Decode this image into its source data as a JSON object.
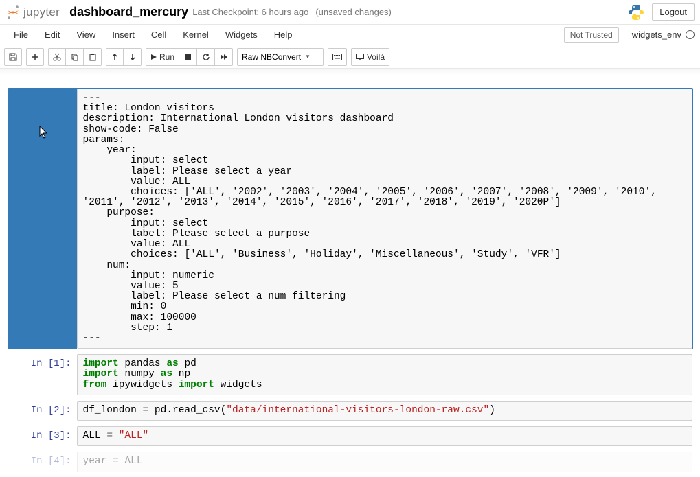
{
  "header": {
    "logo_text": "jupyter",
    "notebook_name": "dashboard_mercury",
    "checkpoint": "Last Checkpoint: 6 hours ago",
    "unsaved": "(unsaved changes)",
    "logout": "Logout"
  },
  "menu": {
    "items": [
      "File",
      "Edit",
      "View",
      "Insert",
      "Cell",
      "Kernel",
      "Widgets",
      "Help"
    ],
    "not_trusted": "Not Trusted",
    "kernel_name": "widgets_env"
  },
  "toolbar": {
    "run_label": "Run",
    "celltype": "Raw NBConvert",
    "voila": "Voilà"
  },
  "cells": {
    "raw0": "---\ntitle: London visitors\ndescription: International London visitors dashboard\nshow-code: False\nparams:\n    year:\n        input: select\n        label: Please select a year\n        value: ALL\n        choices: ['ALL', '2002', '2003', '2004', '2005', '2006', '2007', '2008', '2009', '2010', '2011', '2012', '2013', '2014', '2015', '2016', '2017', '2018', '2019', '2020P']\n    purpose:\n        input: select\n        label: Please select a purpose\n        value: ALL\n        choices: ['ALL', 'Business', 'Holiday', 'Miscellaneous', 'Study', 'VFR']\n    num:\n        input: numeric\n        value: 5\n        label: Please select a num filtering\n        min: 0\n        max: 100000\n        step: 1\n---",
    "c1_prompt": "In [1]:",
    "c2_prompt": "In [2]:",
    "c3_prompt": "In [3]:",
    "c4_prompt": "In [4]:",
    "c2_str": "\"data/international-visitors-london-raw.csv\"",
    "c3_str": "\"ALL\""
  }
}
